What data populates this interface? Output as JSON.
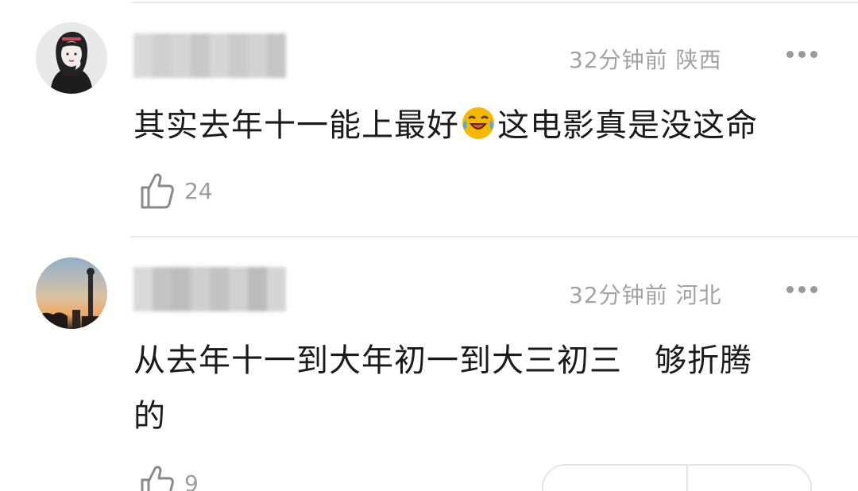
{
  "comments": [
    {
      "time": "32分钟前",
      "location": "陕西",
      "text_before_emoji": "其实去年十一能上最好",
      "emoji": "laughing-crying-emoji",
      "text_after_emoji": "这电影真是没这命",
      "likes": "24"
    },
    {
      "time": "32分钟前",
      "location": "河北",
      "text_line1": "从去年十一到大年初一到大三初三　够折腾",
      "text_line2": "的",
      "likes": "9"
    }
  ],
  "colors": {
    "meta": "#a2a2a2",
    "text": "#1b1b1b",
    "divider": "#e9e9e9"
  }
}
